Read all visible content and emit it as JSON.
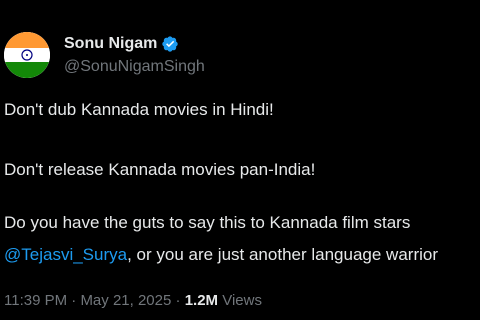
{
  "author": {
    "name": "Sonu Nigam",
    "handle": "@SonuNigamSingh",
    "verified_icon": "verified-badge-icon",
    "avatar_icon": "india-flag-avatar"
  },
  "tweet": {
    "line1": "Don't dub Kannada movies in Hindi!",
    "line2": "Don't release Kannada movies pan-India!",
    "line3": "Do you have the guts to say this to Kannada film stars",
    "line4_mention": "@Tejasvi_Surya",
    "line4_rest": ", or you are just another language warrior"
  },
  "meta": {
    "time": "11:39 PM",
    "sep1": " · ",
    "date": "May 21, 2025",
    "sep2": " · ",
    "views_count": "1.2M",
    "views_label": " Views"
  },
  "colors": {
    "background": "#000000",
    "text": "#e7e9ea",
    "secondary": "#71767b",
    "link": "#1d9bf0",
    "verified": "#1d9bf0"
  }
}
